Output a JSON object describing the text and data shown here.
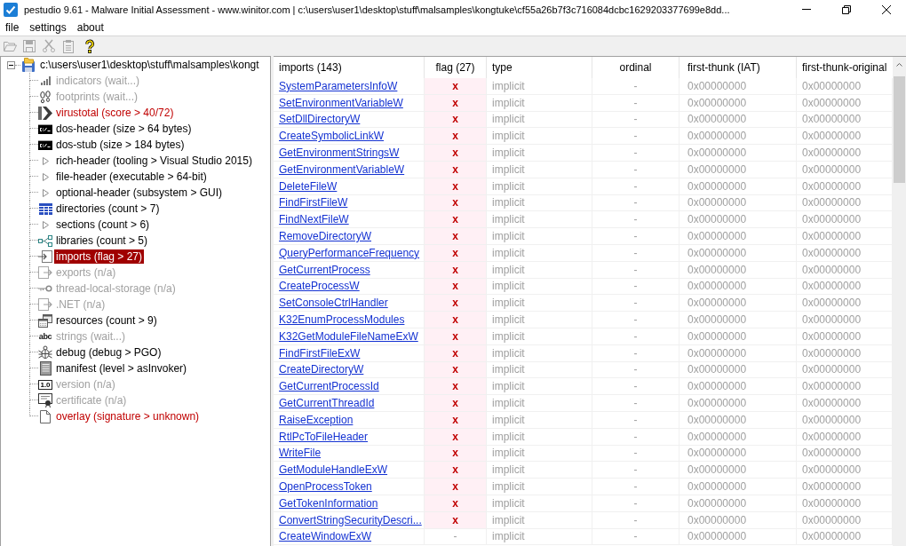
{
  "window": {
    "title": "pestudio 9.61 - Malware Initial Assessment - www.winitor.com | c:\\users\\user1\\desktop\\stuff\\malsamples\\kongtuke\\cf55a26b7f3c716084dcbc1629203377699e8dd..."
  },
  "menu": [
    "file",
    "settings",
    "about"
  ],
  "toolbar": [
    {
      "disabled": true
    },
    {
      "disabled": true
    },
    {
      "disabled": true
    },
    {
      "disabled": true
    },
    {
      "disabled": false
    }
  ],
  "tree": {
    "root": {
      "label": "c:\\users\\user1\\desktop\\stuff\\malsamples\\kongt",
      "expanded": true,
      "selected": false,
      "children": [
        {
          "label": "indicators (wait...)",
          "disabled": true,
          "alert": false,
          "selected": false
        },
        {
          "label": "footprints (wait...)",
          "disabled": true,
          "alert": false,
          "selected": false
        },
        {
          "label": "virustotal (score > 40/72)",
          "disabled": false,
          "alert": true,
          "selected": false
        },
        {
          "label": "dos-header (size > 64 bytes)",
          "disabled": false,
          "alert": false,
          "selected": false
        },
        {
          "label": "dos-stub (size > 184 bytes)",
          "disabled": false,
          "alert": false,
          "selected": false
        },
        {
          "label": "rich-header (tooling > Visual Studio 2015)",
          "disabled": false,
          "alert": false,
          "selected": false
        },
        {
          "label": "file-header (executable > 64-bit)",
          "disabled": false,
          "alert": false,
          "selected": false
        },
        {
          "label": "optional-header (subsystem > GUI)",
          "disabled": false,
          "alert": false,
          "selected": false
        },
        {
          "label": "directories (count > 7)",
          "disabled": false,
          "alert": false,
          "selected": false
        },
        {
          "label": "sections (count > 6)",
          "disabled": false,
          "alert": false,
          "selected": false
        },
        {
          "label": "libraries (count > 5)",
          "disabled": false,
          "alert": false,
          "selected": false
        },
        {
          "label": "imports (flag > 27)",
          "disabled": false,
          "alert": true,
          "selected": true
        },
        {
          "label": "exports (n/a)",
          "disabled": true,
          "alert": false,
          "selected": false
        },
        {
          "label": "thread-local-storage (n/a)",
          "disabled": true,
          "alert": false,
          "selected": false
        },
        {
          "label": ".NET (n/a)",
          "disabled": true,
          "alert": false,
          "selected": false
        },
        {
          "label": "resources (count > 9)",
          "disabled": false,
          "alert": false,
          "selected": false
        },
        {
          "label": "strings (wait...)",
          "icon_label": "abc",
          "disabled": true,
          "alert": false,
          "selected": false
        },
        {
          "label": "debug (debug > PGO)",
          "disabled": false,
          "alert": false,
          "selected": false
        },
        {
          "label": "manifest (level > asInvoker)",
          "disabled": false,
          "alert": false,
          "selected": false
        },
        {
          "label": "version (n/a)",
          "icon_label": "1.0",
          "disabled": true,
          "alert": false,
          "selected": false
        },
        {
          "label": "certificate (n/a)",
          "disabled": true,
          "alert": false,
          "selected": false
        },
        {
          "label": "overlay (signature > unknown)",
          "disabled": false,
          "alert": true,
          "selected": false
        }
      ]
    }
  },
  "table": {
    "columns": [
      "imports (143)",
      "flag (27)",
      "type",
      "ordinal",
      "first-thunk (IAT)",
      "first-thunk-original"
    ],
    "rows": [
      {
        "name": "SystemParametersInfoW",
        "flag": "x",
        "flagged": true,
        "type": "implicit",
        "ordinal": "-",
        "first_thunk_iat": "0x00000000",
        "first_thunk_original": "0x00000000"
      },
      {
        "name": "SetEnvironmentVariableW",
        "flag": "x",
        "flagged": true,
        "type": "implicit",
        "ordinal": "-",
        "first_thunk_iat": "0x00000000",
        "first_thunk_original": "0x00000000"
      },
      {
        "name": "SetDllDirectoryW",
        "flag": "x",
        "flagged": true,
        "type": "implicit",
        "ordinal": "-",
        "first_thunk_iat": "0x00000000",
        "first_thunk_original": "0x00000000"
      },
      {
        "name": "CreateSymbolicLinkW",
        "flag": "x",
        "flagged": true,
        "type": "implicit",
        "ordinal": "-",
        "first_thunk_iat": "0x00000000",
        "first_thunk_original": "0x00000000"
      },
      {
        "name": "GetEnvironmentStringsW",
        "flag": "x",
        "flagged": true,
        "type": "implicit",
        "ordinal": "-",
        "first_thunk_iat": "0x00000000",
        "first_thunk_original": "0x00000000"
      },
      {
        "name": "GetEnvironmentVariableW",
        "flag": "x",
        "flagged": true,
        "type": "implicit",
        "ordinal": "-",
        "first_thunk_iat": "0x00000000",
        "first_thunk_original": "0x00000000"
      },
      {
        "name": "DeleteFileW",
        "flag": "x",
        "flagged": true,
        "type": "implicit",
        "ordinal": "-",
        "first_thunk_iat": "0x00000000",
        "first_thunk_original": "0x00000000"
      },
      {
        "name": "FindFirstFileW",
        "flag": "x",
        "flagged": true,
        "type": "implicit",
        "ordinal": "-",
        "first_thunk_iat": "0x00000000",
        "first_thunk_original": "0x00000000"
      },
      {
        "name": "FindNextFileW",
        "flag": "x",
        "flagged": true,
        "type": "implicit",
        "ordinal": "-",
        "first_thunk_iat": "0x00000000",
        "first_thunk_original": "0x00000000"
      },
      {
        "name": "RemoveDirectoryW",
        "flag": "x",
        "flagged": true,
        "type": "implicit",
        "ordinal": "-",
        "first_thunk_iat": "0x00000000",
        "first_thunk_original": "0x00000000"
      },
      {
        "name": "QueryPerformanceFrequency",
        "flag": "x",
        "flagged": true,
        "type": "implicit",
        "ordinal": "-",
        "first_thunk_iat": "0x00000000",
        "first_thunk_original": "0x00000000"
      },
      {
        "name": "GetCurrentProcess",
        "flag": "x",
        "flagged": true,
        "type": "implicit",
        "ordinal": "-",
        "first_thunk_iat": "0x00000000",
        "first_thunk_original": "0x00000000"
      },
      {
        "name": "CreateProcessW",
        "flag": "x",
        "flagged": true,
        "type": "implicit",
        "ordinal": "-",
        "first_thunk_iat": "0x00000000",
        "first_thunk_original": "0x00000000"
      },
      {
        "name": "SetConsoleCtrlHandler",
        "flag": "x",
        "flagged": true,
        "type": "implicit",
        "ordinal": "-",
        "first_thunk_iat": "0x00000000",
        "first_thunk_original": "0x00000000"
      },
      {
        "name": "K32EnumProcessModules",
        "flag": "x",
        "flagged": true,
        "type": "implicit",
        "ordinal": "-",
        "first_thunk_iat": "0x00000000",
        "first_thunk_original": "0x00000000"
      },
      {
        "name": "K32GetModuleFileNameExW",
        "flag": "x",
        "flagged": true,
        "type": "implicit",
        "ordinal": "-",
        "first_thunk_iat": "0x00000000",
        "first_thunk_original": "0x00000000"
      },
      {
        "name": "FindFirstFileExW",
        "flag": "x",
        "flagged": true,
        "type": "implicit",
        "ordinal": "-",
        "first_thunk_iat": "0x00000000",
        "first_thunk_original": "0x00000000"
      },
      {
        "name": "CreateDirectoryW",
        "flag": "x",
        "flagged": true,
        "type": "implicit",
        "ordinal": "-",
        "first_thunk_iat": "0x00000000",
        "first_thunk_original": "0x00000000"
      },
      {
        "name": "GetCurrentProcessId",
        "flag": "x",
        "flagged": true,
        "type": "implicit",
        "ordinal": "-",
        "first_thunk_iat": "0x00000000",
        "first_thunk_original": "0x00000000"
      },
      {
        "name": "GetCurrentThreadId",
        "flag": "x",
        "flagged": true,
        "type": "implicit",
        "ordinal": "-",
        "first_thunk_iat": "0x00000000",
        "first_thunk_original": "0x00000000"
      },
      {
        "name": "RaiseException",
        "flag": "x",
        "flagged": true,
        "type": "implicit",
        "ordinal": "-",
        "first_thunk_iat": "0x00000000",
        "first_thunk_original": "0x00000000"
      },
      {
        "name": "RtlPcToFileHeader",
        "flag": "x",
        "flagged": true,
        "type": "implicit",
        "ordinal": "-",
        "first_thunk_iat": "0x00000000",
        "first_thunk_original": "0x00000000"
      },
      {
        "name": "WriteFile",
        "flag": "x",
        "flagged": true,
        "type": "implicit",
        "ordinal": "-",
        "first_thunk_iat": "0x00000000",
        "first_thunk_original": "0x00000000"
      },
      {
        "name": "GetModuleHandleExW",
        "flag": "x",
        "flagged": true,
        "type": "implicit",
        "ordinal": "-",
        "first_thunk_iat": "0x00000000",
        "first_thunk_original": "0x00000000"
      },
      {
        "name": "OpenProcessToken",
        "flag": "x",
        "flagged": true,
        "type": "implicit",
        "ordinal": "-",
        "first_thunk_iat": "0x00000000",
        "first_thunk_original": "0x00000000"
      },
      {
        "name": "GetTokenInformation",
        "flag": "x",
        "flagged": true,
        "type": "implicit",
        "ordinal": "-",
        "first_thunk_iat": "0x00000000",
        "first_thunk_original": "0x00000000"
      },
      {
        "name": "ConvertStringSecurityDescri...",
        "flag": "x",
        "flagged": true,
        "type": "implicit",
        "ordinal": "-",
        "first_thunk_iat": "0x00000000",
        "first_thunk_original": "0x00000000"
      },
      {
        "name": "CreateWindowExW",
        "flag": "-",
        "flagged": false,
        "type": "implicit",
        "ordinal": "-",
        "first_thunk_iat": "0x00000000",
        "first_thunk_original": "0x00000000"
      }
    ]
  }
}
